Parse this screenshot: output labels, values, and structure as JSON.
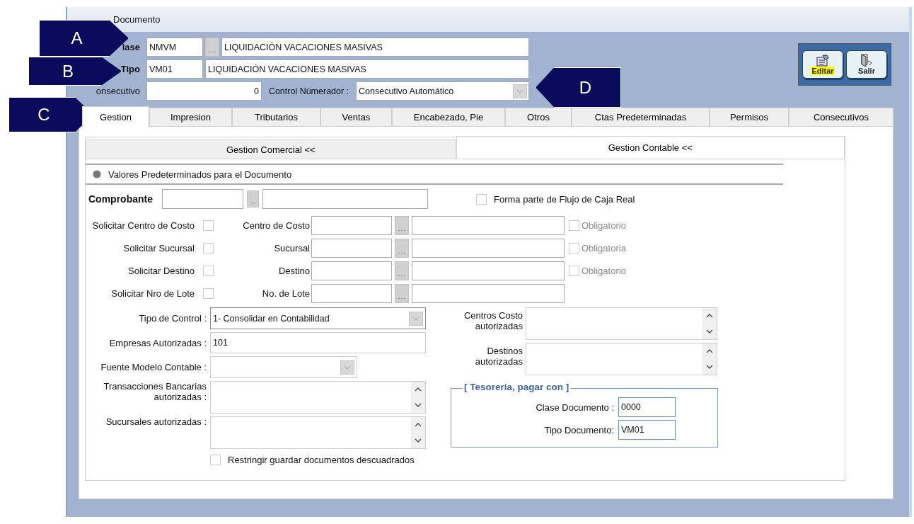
{
  "window": {
    "title": "Documento"
  },
  "callouts": [
    {
      "label": "A",
      "kind": "right"
    },
    {
      "label": "B",
      "kind": "right"
    },
    {
      "label": "C",
      "kind": "right"
    },
    {
      "label": "D",
      "kind": "left"
    }
  ],
  "header": {
    "clase": {
      "label": "lase",
      "code": "NMVM",
      "name": "LIQUIDACIÓN VACACIONES MASIVAS"
    },
    "tipo": {
      "label": "Tipo",
      "code": "VM01",
      "name": "LIQUIDACIÓN VACACIONES MASIVAS"
    },
    "consecutivo": {
      "label": "onsecutivo",
      "value": "0"
    },
    "control_numerador": {
      "label": "Control Númerador :",
      "value": "Consecutivo Automático"
    }
  },
  "toolbar": [
    {
      "label": "Editar",
      "kind": "edit"
    },
    {
      "label": "Salir",
      "kind": "exit"
    }
  ],
  "tabs": [
    {
      "label": "Gestion",
      "selected": true
    },
    {
      "label": "Impresion",
      "selected": false
    },
    {
      "label": "Tributarios",
      "selected": false
    },
    {
      "label": "Ventas",
      "selected": false
    },
    {
      "label": "Encabezado, Pie",
      "selected": false
    },
    {
      "label": "Otros",
      "selected": false
    },
    {
      "label": "Ctas Predeterminadas",
      "selected": false
    },
    {
      "label": "Permisos",
      "selected": false
    },
    {
      "label": "Consecutivos",
      "selected": false
    }
  ],
  "subtabs": [
    {
      "label": "Gestion Comercial <<",
      "selected": false
    },
    {
      "label": "Gestion Contable <<",
      "selected": true
    }
  ],
  "section": {
    "title": "Valores Predeterminados para el Documento"
  },
  "comprobante": {
    "label": "Comprobante",
    "flujo_caja": {
      "label": "Forma parte de Flujo de Caja  Real",
      "checked": false
    }
  },
  "lookups": [
    {
      "request_label": "Solicitar Centro de Costo",
      "requested": false,
      "label": "Centro de Costo",
      "required": {
        "label": "Obligatorio",
        "checked": false,
        "disabled": true
      }
    },
    {
      "request_label": "Solicitar Sucursal",
      "requested": false,
      "label": "Sucursal",
      "required": {
        "label": "Obligatoria",
        "checked": false,
        "disabled": true
      }
    },
    {
      "request_label": "Solicitar Destino",
      "requested": false,
      "label": "Destino",
      "required": {
        "label": "Obligatorio",
        "checked": false,
        "disabled": true
      }
    },
    {
      "request_label": "Solicitar Nro de  Lote",
      "requested": false,
      "label": "No. de Lote"
    }
  ],
  "left_fields": [
    {
      "kind": "select",
      "label": "Tipo de Control :",
      "value": "1- Consolidar en Contabilidad"
    },
    {
      "kind": "input",
      "label": "Empresas Autorizadas :",
      "value": "101"
    },
    {
      "kind": "select_short",
      "label": "Fuente Modelo Contable :"
    },
    {
      "kind": "list",
      "label": "Transacciones Bancarias autorizadas :"
    },
    {
      "kind": "list",
      "label": "Sucursales autorizadas :"
    }
  ],
  "restringir": {
    "label": "Restringir guardar documentos descuadrados",
    "checked": false
  },
  "right_fields": [
    {
      "label": "Centros Costo autorizadas"
    },
    {
      "label": "Destinos autorizadas"
    }
  ],
  "tesoreria": {
    "title": "[ Tesoreria, pagar con ]",
    "fields": [
      {
        "label": "Clase Documento :",
        "value": "0000"
      },
      {
        "label": "Tipo Documento:",
        "value": "VM01"
      }
    ]
  }
}
